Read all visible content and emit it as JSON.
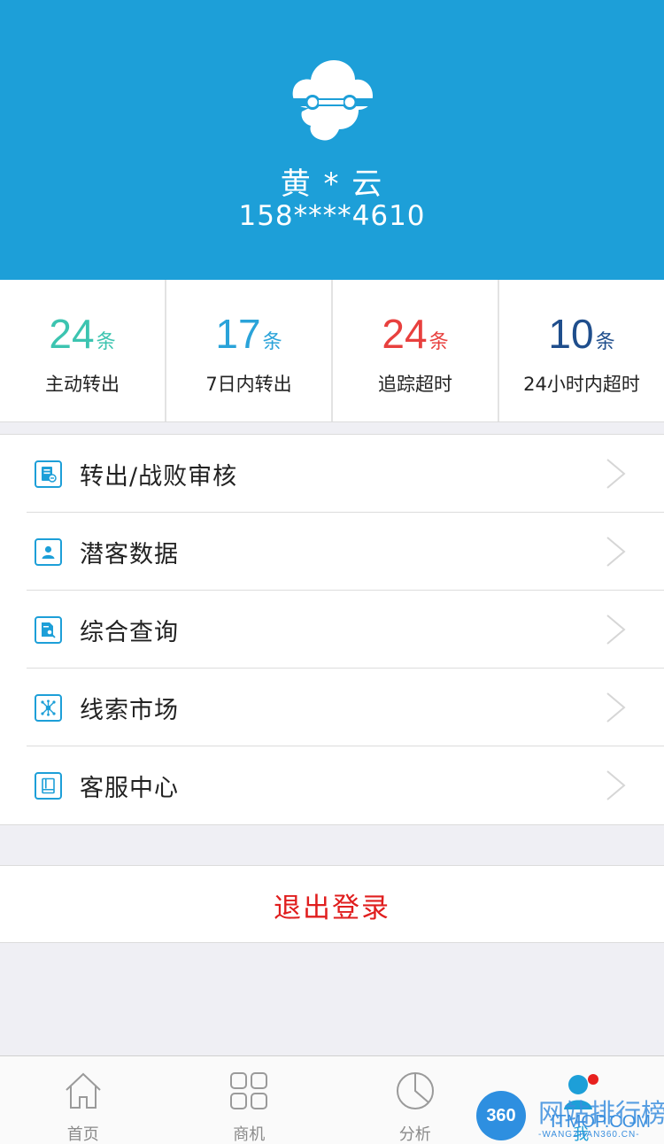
{
  "profile": {
    "name": "黄 * 云",
    "phone": "158****4610"
  },
  "stats": [
    {
      "value": "24",
      "unit": "条",
      "label": "主动转出",
      "color": "#3cc4b0"
    },
    {
      "value": "17",
      "unit": "条",
      "label": "7日内转出",
      "color": "#2aa3d9"
    },
    {
      "value": "24",
      "unit": "条",
      "label": "追踪超时",
      "color": "#e8403e"
    },
    {
      "value": "10",
      "unit": "条",
      "label": "24小时内超时",
      "color": "#1f4e8c"
    }
  ],
  "menu": {
    "items": [
      {
        "label": "转出/战败审核",
        "icon": "document-check-icon"
      },
      {
        "label": "潜客数据",
        "icon": "person-card-icon"
      },
      {
        "label": "综合查询",
        "icon": "document-search-icon"
      },
      {
        "label": "线索市场",
        "icon": "network-icon"
      },
      {
        "label": "客服中心",
        "icon": "book-icon"
      }
    ]
  },
  "logout": {
    "label": "退出登录"
  },
  "tabbar": {
    "tabs": [
      {
        "label": "首页",
        "icon": "home-icon"
      },
      {
        "label": "商机",
        "icon": "grid-icon"
      },
      {
        "label": "分析",
        "icon": "pie-chart-icon"
      },
      {
        "label": "我",
        "icon": "user-icon"
      }
    ]
  },
  "watermark": {
    "badge": "360",
    "title": "网站排行榜",
    "domain": "ITMOP.COM",
    "sub": "-WANGZHAN360.CN-"
  },
  "colors": {
    "header": "#1d9fd8",
    "accent": "#1d9fd8",
    "logout": "#e01e1e",
    "background": "#efeff4"
  }
}
